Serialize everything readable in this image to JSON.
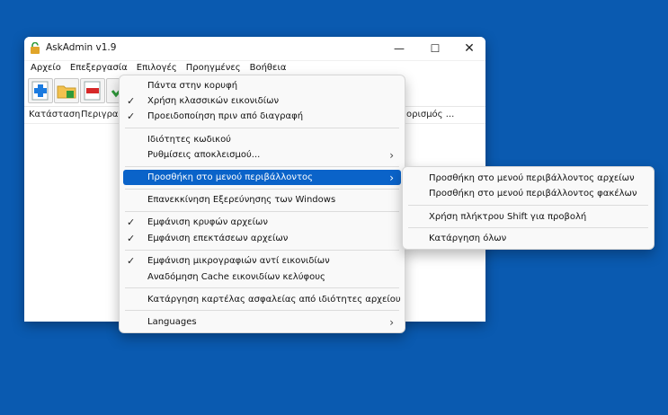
{
  "window": {
    "title": "AskAdmin v1.9",
    "minimize": "—",
    "maximize": "☐",
    "close": "✕"
  },
  "menubar": [
    "Αρχείο",
    "Επεξεργασία",
    "Επιλογές",
    "Προηγμένες",
    "Βοήθεια"
  ],
  "columns": {
    "status": "Κατάσταση",
    "description": "Περιγραφ",
    "definition": "ορισμός ..."
  },
  "options_menu": {
    "always_on_top": "Πάντα στην κορυφή",
    "classic_icons": "Χρήση κλασσικών εικονιδίων",
    "warn_delete": "Προειδοποίηση πριν από διαγραφή",
    "code_properties": "Ιδιότητες κωδικού",
    "block_settings": "Ρυθμίσεις αποκλεισμού...",
    "context_menu": "Προσθήκη στο μενού περιβάλλοντος",
    "restart_explorer": "Επανεκκίνηση Εξερεύνησης των Windows",
    "show_hidden": "Εμφάνιση κρυφών αρχείων",
    "show_extensions": "Εμφάνιση επεκτάσεων αρχείων",
    "show_thumbnails": "Εμφάνιση μικρογραφιών αντί εικονιδίων",
    "rebuild_cache": "Αναδόμηση Cache εικονιδίων κελύφους",
    "remove_security_tab": "Κατάργηση καρτέλας ασφαλείας από ιδιότητες αρχείου",
    "languages": "Languages",
    "check": "✓",
    "arrow": "›"
  },
  "context_submenu": {
    "files": "Προσθήκη στο μενού περιβάλλοντος αρχείων",
    "folders": "Προσθήκη στο μενού περιβάλλοντος φακέλων",
    "shift_key": "Χρήση πλήκτρου Shift για προβολή",
    "remove_all": "Κατάργηση όλων"
  },
  "colors": {
    "desktop": "#0a5ab0",
    "highlight": "#0a63c9"
  }
}
